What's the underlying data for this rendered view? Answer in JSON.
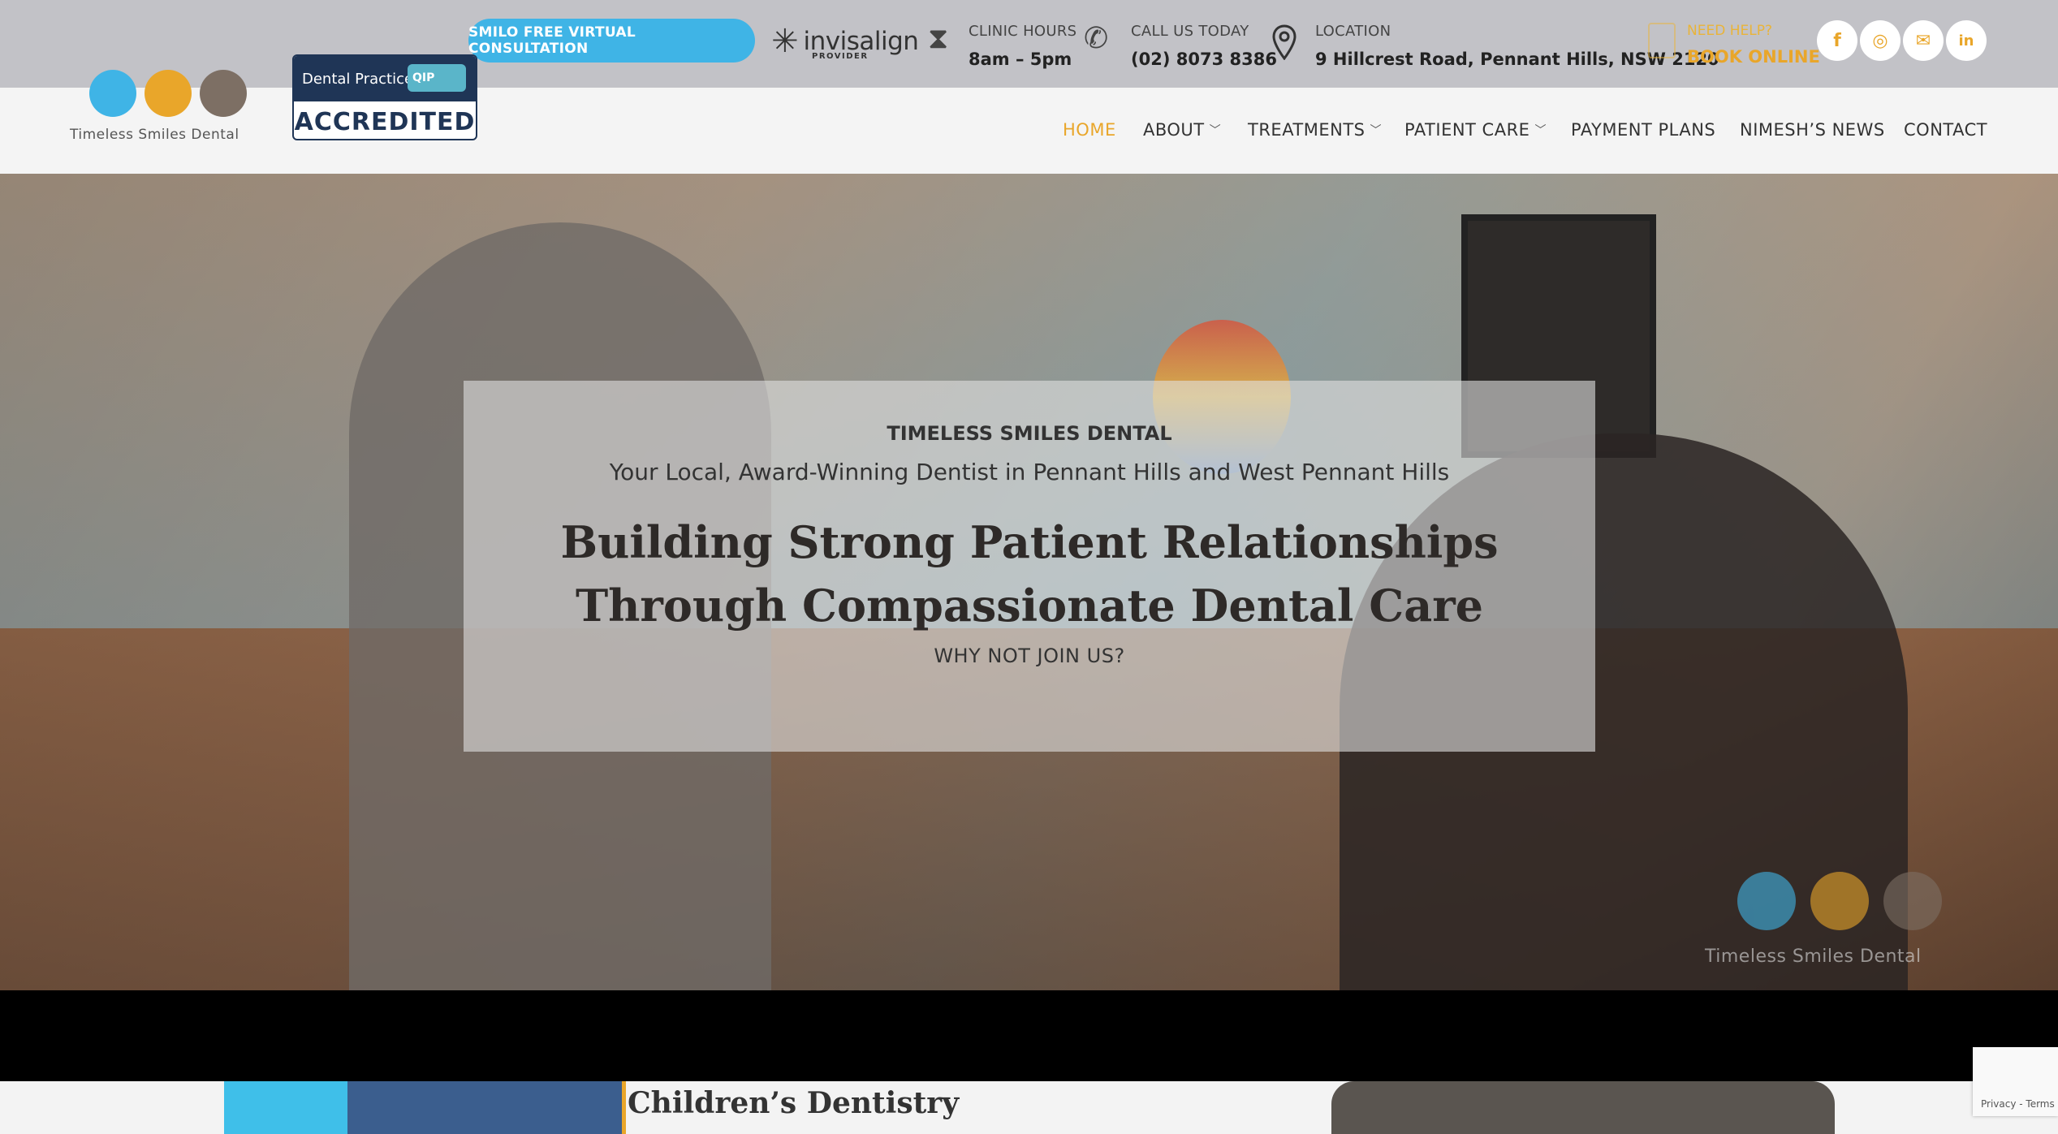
{
  "topbar": {
    "cta_label": "SMILO FREE VIRTUAL CONSULTATION",
    "invisalign_word": "invisalign",
    "invisalign_sub": "PROVIDER",
    "hours_label": "CLINIC HOURS",
    "hours_value": "8am – 5pm",
    "phone_label": "CALL US TODAY",
    "phone_value": "(02) 8073 8386",
    "location_label": "LOCATION",
    "location_value": "9 Hillcrest Road, Pennant Hills, NSW 2120",
    "help_label": "NEED HELP?",
    "help_value": "BOOK ONLINE",
    "social": [
      {
        "icon": "facebook-icon",
        "glyph": "f"
      },
      {
        "icon": "instagram-icon",
        "glyph": "◎"
      },
      {
        "icon": "email-icon",
        "glyph": "✉"
      },
      {
        "icon": "linkedin-icon",
        "glyph": "in"
      }
    ]
  },
  "brand": {
    "logo_text": "Timeless Smiles Dental",
    "badge_top": "Dental Practice",
    "badge_qip": "QIP",
    "badge_bottom": "ACCREDITED"
  },
  "nav": {
    "items": [
      {
        "label": "HOME",
        "active": true,
        "dropdown": false
      },
      {
        "label": "ABOUT",
        "active": false,
        "dropdown": true
      },
      {
        "label": "TREATMENTS",
        "active": false,
        "dropdown": true
      },
      {
        "label": "PATIENT CARE",
        "active": false,
        "dropdown": true
      },
      {
        "label": "PAYMENT PLANS",
        "active": false,
        "dropdown": false
      },
      {
        "label": "NIMESH’S NEWS",
        "active": false,
        "dropdown": false
      },
      {
        "label": "CONTACT",
        "active": false,
        "dropdown": false
      }
    ]
  },
  "hero": {
    "eyebrow": "TIMELESS SMILES DENTAL",
    "subtitle": "Your Local, Award-Winning Dentist in Pennant Hills and West Pennant Hills",
    "heading_line1": "Building Strong Patient Relationships",
    "heading_line2": "Through Compassionate Dental Care",
    "cta": "WHY NOT JOIN US?",
    "watermark_text": "Timeless Smiles Dental"
  },
  "lower": {
    "section_title": "Children’s Dentistry"
  },
  "recaptcha": {
    "text": "Privacy - Terms"
  },
  "colors": {
    "accent": "#e9a62a",
    "brand_blue": "#3fb4e6",
    "navy": "#1f3556"
  }
}
